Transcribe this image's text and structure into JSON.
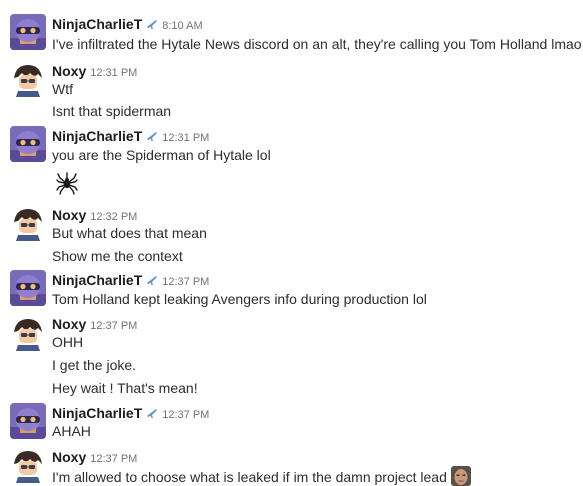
{
  "users": {
    "charlie": {
      "name": "NinjaCharlieT",
      "badge_icon": "airplane-icon",
      "badge_color": "#5a93c6"
    },
    "noxy": {
      "name": "Noxy"
    }
  },
  "messages": [
    {
      "time": "8:10 AM",
      "lines": [
        "I've infiltrated the Hytale News discord on an alt, they're calling you Tom Holland lmao"
      ]
    },
    {
      "time": "12:31 PM",
      "lines": [
        "Wtf",
        "Isnt that spiderman"
      ]
    },
    {
      "time": "12:31 PM",
      "lines": [
        "you are the Spiderman of Hytale lol"
      ],
      "attachment_icon": "spider-emoji-icon"
    },
    {
      "time": "12:32 PM",
      "lines": [
        "But what does that mean",
        "Show me the context"
      ]
    },
    {
      "time": "12:37 PM",
      "lines": [
        "Tom Holland kept leaking Avengers info during production lol"
      ]
    },
    {
      "time": "12:37 PM",
      "lines": [
        "OHH",
        "I get the joke.",
        "Hey wait ! That's mean!"
      ]
    },
    {
      "time": "12:37 PM",
      "lines": [
        "AHAH"
      ]
    },
    {
      "time": "12:37 PM",
      "lines": [
        "I'm allowed to choose what is leaked if im the damn project lead"
      ],
      "trailing_icon": "face-emoji-icon"
    }
  ]
}
